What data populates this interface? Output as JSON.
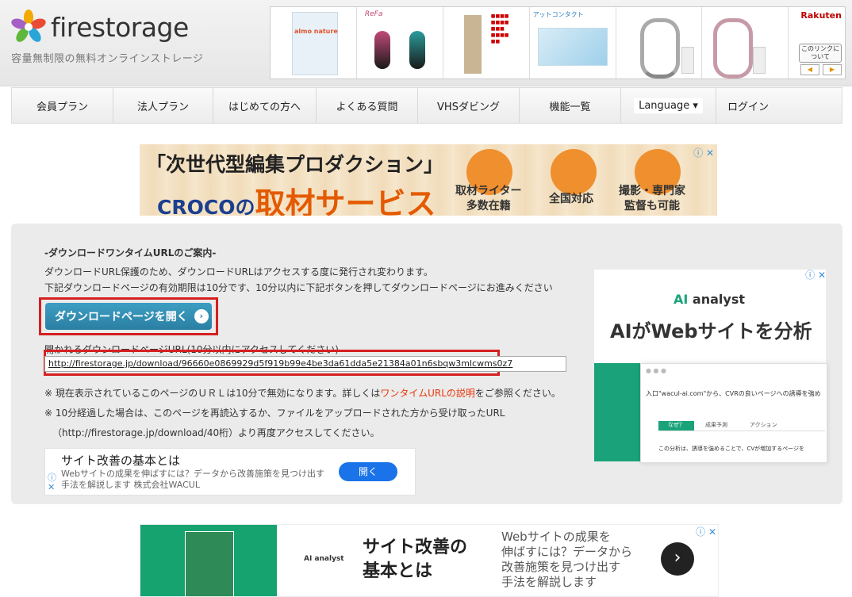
{
  "header": {
    "logo_text": "firestorage",
    "tagline": "容量無制限の無料オンラインストレージ",
    "ad_brand": "Rakuten",
    "ad_info": "このリンクについて",
    "ad_prev": "◀",
    "ad_next": "▶",
    "ad_product_1": "almo nature",
    "ad_product_2": "ReFa",
    "ad_product_4": "アットコンタクト"
  },
  "nav": {
    "items": [
      "会員プラン",
      "法人プラン",
      "はじめての方へ",
      "よくある質問",
      "VHSダビング",
      "機能一覧"
    ],
    "language": "Language ▾",
    "login": "ログイン"
  },
  "banner1": {
    "line1": "「次世代型編集プロダクション」",
    "line2a": "CROCOの",
    "line2b": "取材サービス",
    "cap1": "取材ライター\n多数在籍",
    "cap2": "全国対応",
    "cap3": "撮影・専門家\n監督も可能",
    "ad_marks": "ⓘ ✕"
  },
  "panel": {
    "title": "-ダウンロードワンタイムURLのご案内-",
    "line1": "ダウンロードURL保護のため、ダウンロードURLはアクセスする度に発行され変わります。",
    "line2": "下記ダウンロードページの有効期限は10分です、10分以内に下記ボタンを押してダウンロードページにお進みください",
    "button": "ダウンロードページを開く",
    "button_arrow": "›",
    "url_label": "開かれるダウンロードページURL(10分以内にアクセスしてください)",
    "url_value": "http://firestorage.jp/download/96660e0869929d5f919b99e4be3da61dda5e21384a01n6sbqw3mlcwms0z7",
    "note1_pre": "※ 現在表示されているこのページのＵＲＬは10分で無効になります。詳しくは",
    "note1_link": "ワンタイムURLの説明",
    "note1_post": "をご参照ください。",
    "note2": "※ 10分経過した場合は、このページを再読込するか、ファイルをアップロードされた方から受け取ったURL",
    "note3": "（http://firestorage.jp/download/40桁）より再度アクセスしてください。"
  },
  "sub_ad": {
    "title": "サイト改善の基本とは",
    "desc1": "Webサイトの成果を伸ばすには？データから改善施策を見つけ出す",
    "desc2": "手法を解説します 株式会社WACUL",
    "button": "開く",
    "info_icon": "ⓘ",
    "close_icon": "✕"
  },
  "side_ad": {
    "logo_ai": "AI",
    "logo_rest": "analyst",
    "headline": "AIがWebサイトを分析",
    "card_text": "入口\"wacul-ai.com\"から、CVRの良いページへの誘導を強め",
    "card_tab1": "なぜ？",
    "card_tab2": "成果予測",
    "card_tab3": "アクション",
    "card_foot": "この分析は、誘導を強めることで、CVが増加するページを",
    "marks": "ⓘ ✕"
  },
  "banner2": {
    "title1": "サイト改善の",
    "title2": "基本とは",
    "desc1": "Webサイトの成果を",
    "desc2": "伸ばすには？データから",
    "desc3": "改善施策を見つけ出す",
    "desc4": "手法を解説します",
    "logo": "AI analyst",
    "next": "›",
    "marks": "ⓘ ✕"
  }
}
